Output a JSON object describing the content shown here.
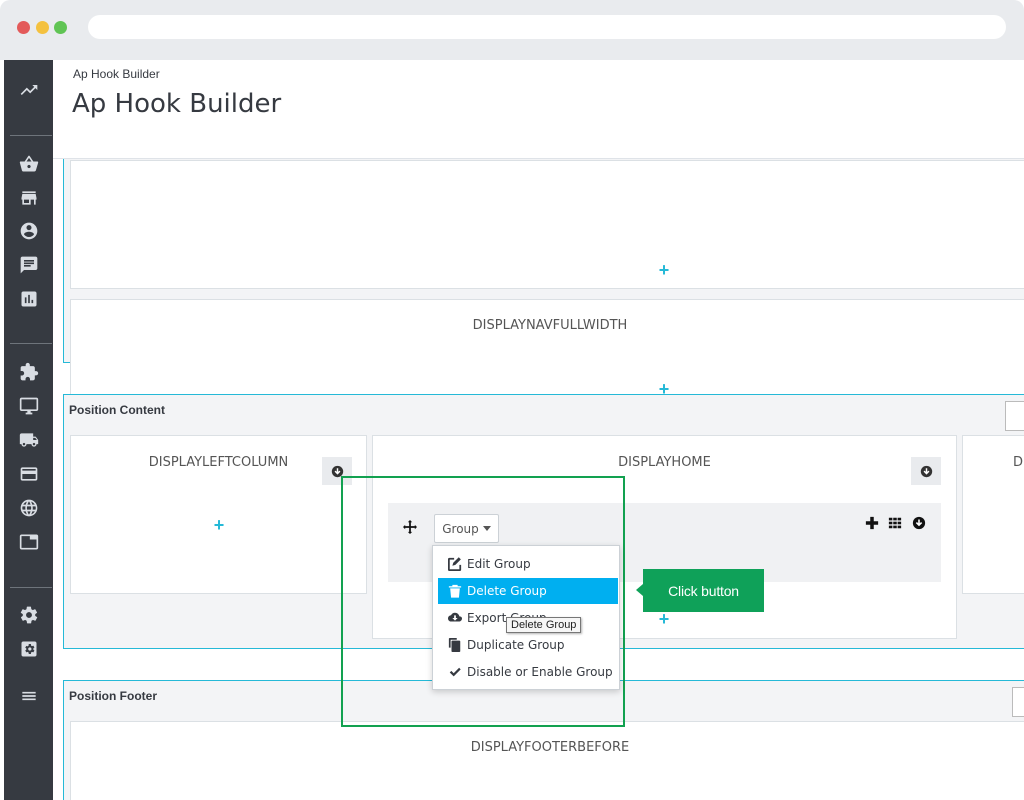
{
  "breadcrumb": "Ap Hook Builder",
  "page_title": "Ap Hook Builder",
  "sidebar_icons": [
    "trending-up-icon",
    "basket-icon",
    "store-icon",
    "customer-icon",
    "message-icon",
    "stats-icon",
    "puzzle-icon",
    "monitor-icon",
    "truck-icon",
    "credit-card-icon",
    "globe-icon",
    "window-icon",
    "settings-icon",
    "advanced-settings-icon",
    "menu-icon"
  ],
  "hooks": {
    "top_unnamed": "",
    "nav_full_width": "DISPLAYNAVFULLWIDTH",
    "left_column": "DISPLAYLEFTCOLUMN",
    "home": "DISPLAYHOME",
    "right_partial": "D",
    "footer_before": "DISPLAYFOOTERBEFORE"
  },
  "sections": {
    "content": "Position Content",
    "footer": "Position Footer"
  },
  "group_button_label": "Group",
  "group_menu": {
    "items": [
      {
        "label": "Edit Group",
        "icon": "edit-icon"
      },
      {
        "label": "Delete Group",
        "icon": "trash-icon",
        "active": true
      },
      {
        "label": "Export Group",
        "icon": "cloud-download-icon"
      },
      {
        "label": "Duplicate Group",
        "icon": "copy-icon"
      },
      {
        "label": "Disable or Enable Group",
        "icon": "check-icon"
      }
    ]
  },
  "tooltip": "Delete Group",
  "callout": "Click button",
  "colors": {
    "accent": "#25b9d7",
    "highlight": "#12a150",
    "menu_active": "#00aff0",
    "sidebar": "#363a41"
  }
}
